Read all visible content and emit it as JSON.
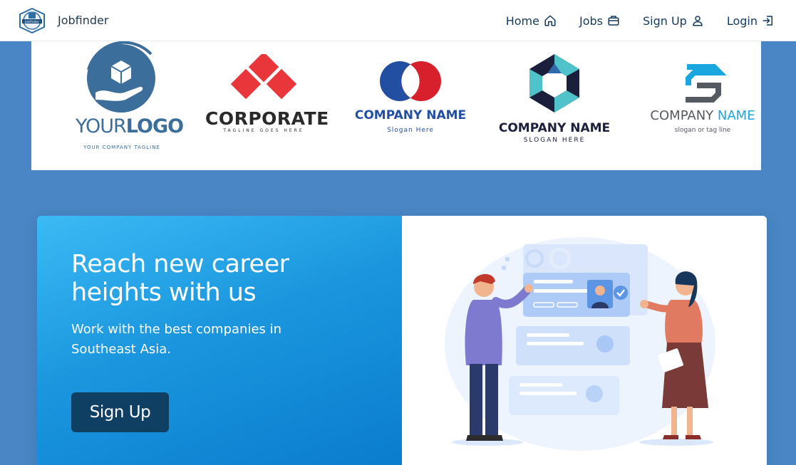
{
  "brand": {
    "name": "Jobfinder",
    "logo_text": "Jobfinder"
  },
  "nav": [
    {
      "label": "Home",
      "icon": "home-icon"
    },
    {
      "label": "Jobs",
      "icon": "briefcase-icon"
    },
    {
      "label": "Sign Up",
      "icon": "user-icon"
    },
    {
      "label": "Login",
      "icon": "login-icon"
    }
  ],
  "logos": [
    {
      "name": "yourlogo",
      "text_a": "YOUR",
      "text_b": "LOGO",
      "tagline": "YOUR COMPANY TAGLINE",
      "color": "#3b6e9a"
    },
    {
      "name": "corporate",
      "text": "CORPORATE",
      "tagline": "TAGLINE GOES HERE",
      "color": "#e8363a"
    },
    {
      "name": "company-name-1",
      "text": "COMPANY NAME",
      "tagline": "Slogan Here",
      "color": "#234fa3"
    },
    {
      "name": "company-name-2",
      "text": "COMPANY NAME",
      "tagline": "SLOGAN HERE",
      "color": "#1b1f3b"
    },
    {
      "name": "company-name-3",
      "text_a": "COMPANY ",
      "text_b": "NAME",
      "tagline": "slogan or tag line",
      "color": "#1aa7df"
    }
  ],
  "hero": {
    "title": "Reach new career heights with us",
    "subtitle": "Work with the best companies in Southeast Asia.",
    "cta_label": "Sign Up"
  },
  "colors": {
    "page_bg": "#4a86c5",
    "nav_text": "#123a5e",
    "hero_gradient_start": "#3bbaf5",
    "hero_gradient_end": "#0a7ccd",
    "cta_bg": "#0f3f63"
  }
}
